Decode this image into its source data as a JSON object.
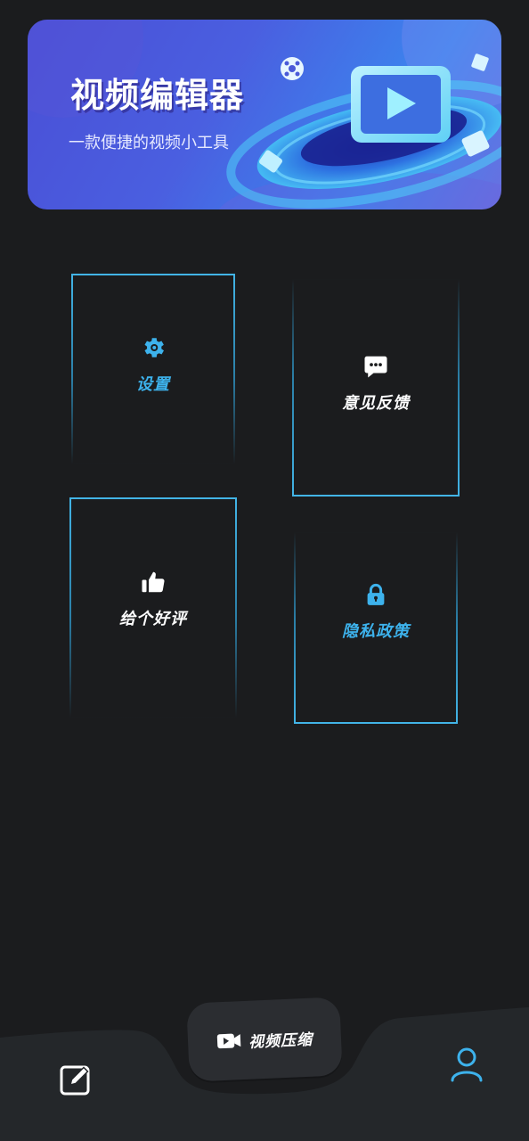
{
  "banner": {
    "title": "视频编辑器",
    "subtitle": "一款便捷的视频小工具"
  },
  "cards": {
    "settings": {
      "label": "设置",
      "icon": "gear-icon"
    },
    "feedback": {
      "label": "意见反馈",
      "icon": "chat-bubble-icon"
    },
    "rate": {
      "label": "给个好评",
      "icon": "thumbs-up-icon"
    },
    "privacy": {
      "label": "隐私政策",
      "icon": "lock-icon"
    }
  },
  "bottom_nav": {
    "left_icon": "edit-icon",
    "center_label": "视频压缩",
    "center_icon": "video-camera-icon",
    "right_icon": "user-profile-icon"
  },
  "colors": {
    "background": "#1b1c1e",
    "accent_blue": "#3db2ec",
    "banner_start": "#4a4fd6",
    "banner_end": "#3b86ee",
    "bottom_bar": "#24272a"
  }
}
